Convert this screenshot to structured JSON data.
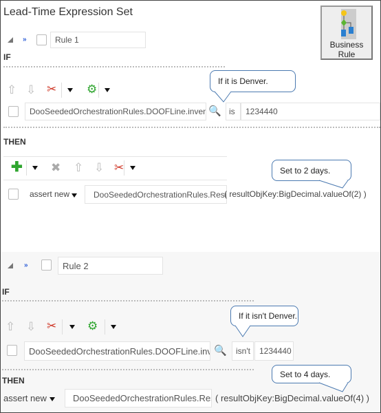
{
  "title": "Lead-Time Expression Set",
  "business_rule_button": {
    "line1": "Business",
    "line2": "Rule",
    "icon": "flowchart-icon"
  },
  "rules": [
    {
      "name": "Rule 1",
      "if_label": "IF",
      "condition": {
        "attribute": "DooSeededOrchestrationRules.DOOFLine.invent",
        "operator": "is",
        "value": "1234440"
      },
      "if_callout": "If it is Denver.",
      "then_label": "THEN",
      "action": {
        "type": "assert new",
        "fact": "DooSeededOrchestrationRules.Result",
        "expression": "( resultObjKey:BigDecimal.valueOf(2) )"
      },
      "then_callout": "Set to 2 days."
    },
    {
      "name": "Rule 2",
      "if_label": "IF",
      "condition": {
        "attribute": "DooSeededOrchestrationRules.DOOFLine.invent",
        "operator": "isn't",
        "value": "1234440"
      },
      "if_callout": "If it isn't Denver.",
      "then_label": "THEN",
      "action": {
        "type": "assert new",
        "fact": "DooSeededOrchestrationRules.Result",
        "expression": "( resultObjKey:BigDecimal.valueOf(4) )"
      },
      "then_callout": "Set to 4 days."
    }
  ],
  "colors": {
    "accent_blue": "#2a5bd7",
    "add_green": "#2fa52f",
    "cut_red": "#d03a2a",
    "callout_border": "#4a79b0"
  }
}
